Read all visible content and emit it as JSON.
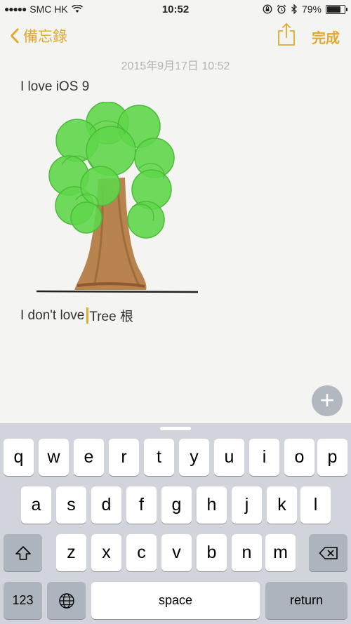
{
  "status_bar": {
    "signal_dots": "●●●●●",
    "carrier": "SMC HK",
    "time": "10:52",
    "battery_percent": "79%",
    "battery_level": 0.79
  },
  "nav": {
    "back_label": "備忘錄",
    "done_label": "完成",
    "accent_color": "#e2a92d"
  },
  "note": {
    "date": "2015年9月17日 10:52",
    "line1": "I love iOS 9",
    "line2_before_caret": "I don't love",
    "line2_after_caret": "Tree 根"
  },
  "add_button": "+",
  "keyboard": {
    "row1": [
      "q",
      "w",
      "e",
      "r",
      "t",
      "y",
      "u",
      "i",
      "o",
      "p"
    ],
    "row2": [
      "a",
      "s",
      "d",
      "f",
      "g",
      "h",
      "j",
      "k",
      "l"
    ],
    "row3": [
      "z",
      "x",
      "c",
      "v",
      "b",
      "n",
      "m"
    ],
    "numbers_key": "123",
    "space_key": "space",
    "return_key": "return"
  }
}
